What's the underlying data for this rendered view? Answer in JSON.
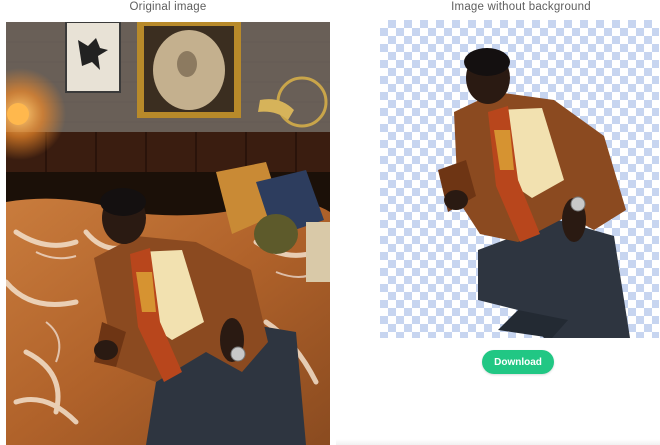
{
  "left_panel": {
    "title": "Original image"
  },
  "right_panel": {
    "title": "Image without background",
    "download_label": "Download"
  },
  "colors": {
    "button_green": "#21c784",
    "checker_blue": "#c7d5f0",
    "title_gray": "#5e5e5e"
  }
}
